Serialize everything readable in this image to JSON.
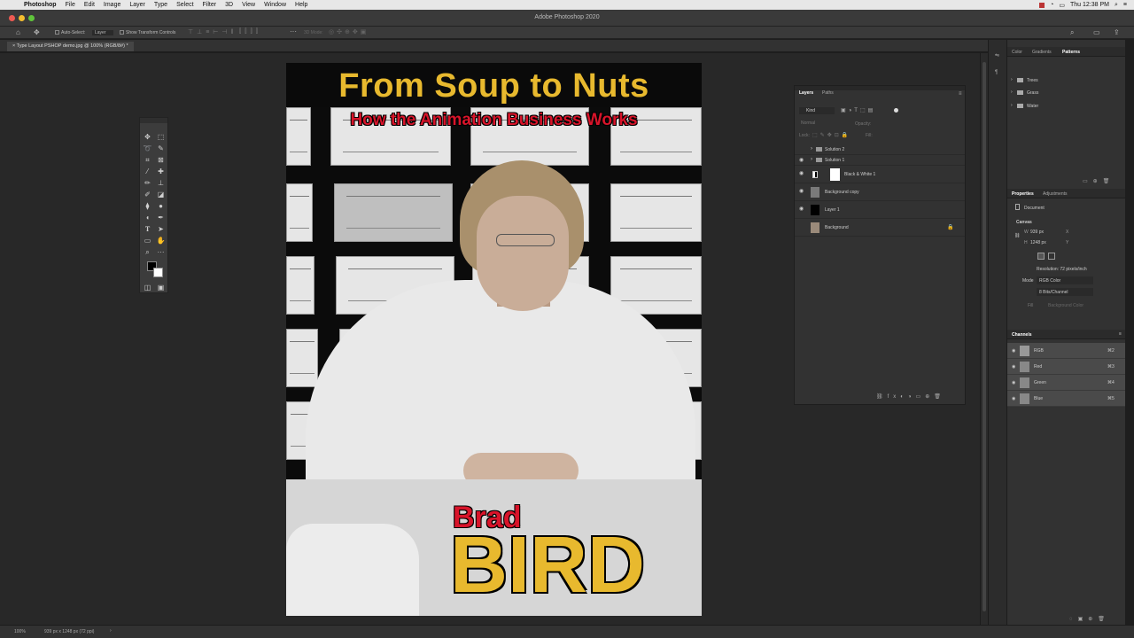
{
  "menubar": {
    "app": "Photoshop",
    "items": [
      "File",
      "Edit",
      "Image",
      "Layer",
      "Type",
      "Select",
      "Filter",
      "3D",
      "View",
      "Window",
      "Help"
    ],
    "clock": "Thu 12:38 PM"
  },
  "window": {
    "title": "Adobe Photoshop 2020"
  },
  "options": {
    "auto_select": "Auto-Select:",
    "auto_select_value": "Layer",
    "transform_controls": "Show Transform Controls",
    "mode_3d": "3D Mode:"
  },
  "document": {
    "tab": "Type Layout PSHOP demo.jpg @ 100% (RGB/8#) *",
    "zoom": "100%",
    "info": "939 px x 1248 px (72 ppi)"
  },
  "poster": {
    "title": "From Soup to Nuts",
    "subtitle": "How the Animation Business Works",
    "first_name": "Brad",
    "last_name": "BIRD"
  },
  "layers_panel": {
    "tabs": [
      "Layers",
      "Paths"
    ],
    "kind": "Kind",
    "blend_mode": "Normal",
    "opacity_label": "Opacity:",
    "lock_label": "Lock:",
    "fill_label": "Fill:",
    "layers": [
      {
        "name": "Solution 2",
        "type": "group",
        "visible": false
      },
      {
        "name": "Solution 1",
        "type": "group",
        "visible": true
      },
      {
        "name": "Black & White 1",
        "type": "adjustment",
        "visible": true
      },
      {
        "name": "Background copy",
        "type": "image",
        "visible": true
      },
      {
        "name": "Layer 1",
        "type": "fill",
        "visible": true
      },
      {
        "name": "Background",
        "type": "image",
        "visible": false,
        "locked": true
      }
    ]
  },
  "top_right_panel": {
    "tabs": [
      "Color",
      "Gradients",
      "Patterns"
    ],
    "folders": [
      "Trees",
      "Grass",
      "Water"
    ]
  },
  "properties_panel": {
    "tabs": [
      "Properties",
      "Adjustments"
    ],
    "doc_label": "Document",
    "canvas_label": "Canvas",
    "w_label": "W",
    "w_value": "939 px",
    "h_label": "H",
    "h_value": "1248 px",
    "x_label": "X",
    "y_label": "Y",
    "resolution": "Resolution: 72 pixels/inch",
    "mode_label": "Mode",
    "mode_value": "RGB Color",
    "depth_value": "8 Bits/Channel",
    "fill_label": "Fill",
    "fill_value": "Background Color"
  },
  "channels_panel": {
    "title": "Channels",
    "channels": [
      {
        "name": "RGB",
        "shortcut": "⌘2"
      },
      {
        "name": "Red",
        "shortcut": "⌘3"
      },
      {
        "name": "Green",
        "shortcut": "⌘4"
      },
      {
        "name": "Blue",
        "shortcut": "⌘5"
      }
    ]
  },
  "colors": {
    "poster_gold": "#e8b92e",
    "poster_red": "#d8142a",
    "ui_panel": "#323232",
    "accent_blue": "#1473e6"
  }
}
